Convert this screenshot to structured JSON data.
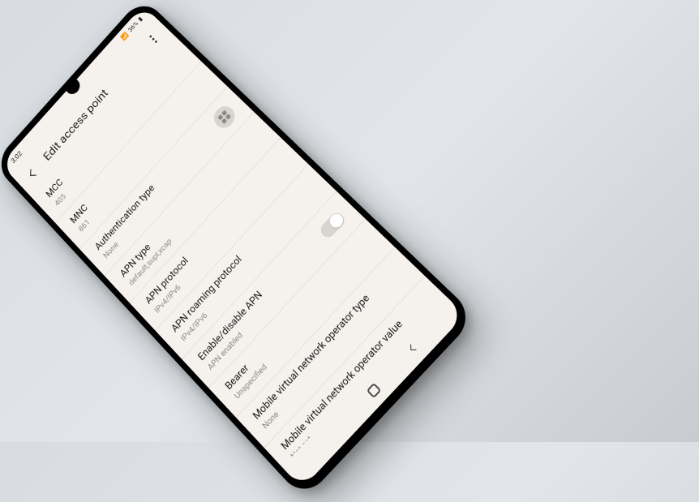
{
  "statusbar": {
    "time": "3:02",
    "battery": "36%"
  },
  "appbar": {
    "title": "Edit access point"
  },
  "rows": [
    {
      "label": "MCC",
      "value": "405"
    },
    {
      "label": "MNC",
      "value": "861"
    },
    {
      "label": "Authentication type",
      "value": "None"
    },
    {
      "label": "APN type",
      "value": "default,supl,xcap"
    },
    {
      "label": "APN protocol",
      "value": "IPv4/IPv6"
    },
    {
      "label": "APN roaming protocol",
      "value": "IPv4/IPv6"
    },
    {
      "label": "Enable/disable APN",
      "value": "APN enabled"
    },
    {
      "label": "Bearer",
      "value": "Unspecified"
    },
    {
      "label": "Mobile virtual network operator type",
      "value": "None"
    },
    {
      "label": "Mobile virtual network operator value",
      "value": "Not set"
    }
  ]
}
